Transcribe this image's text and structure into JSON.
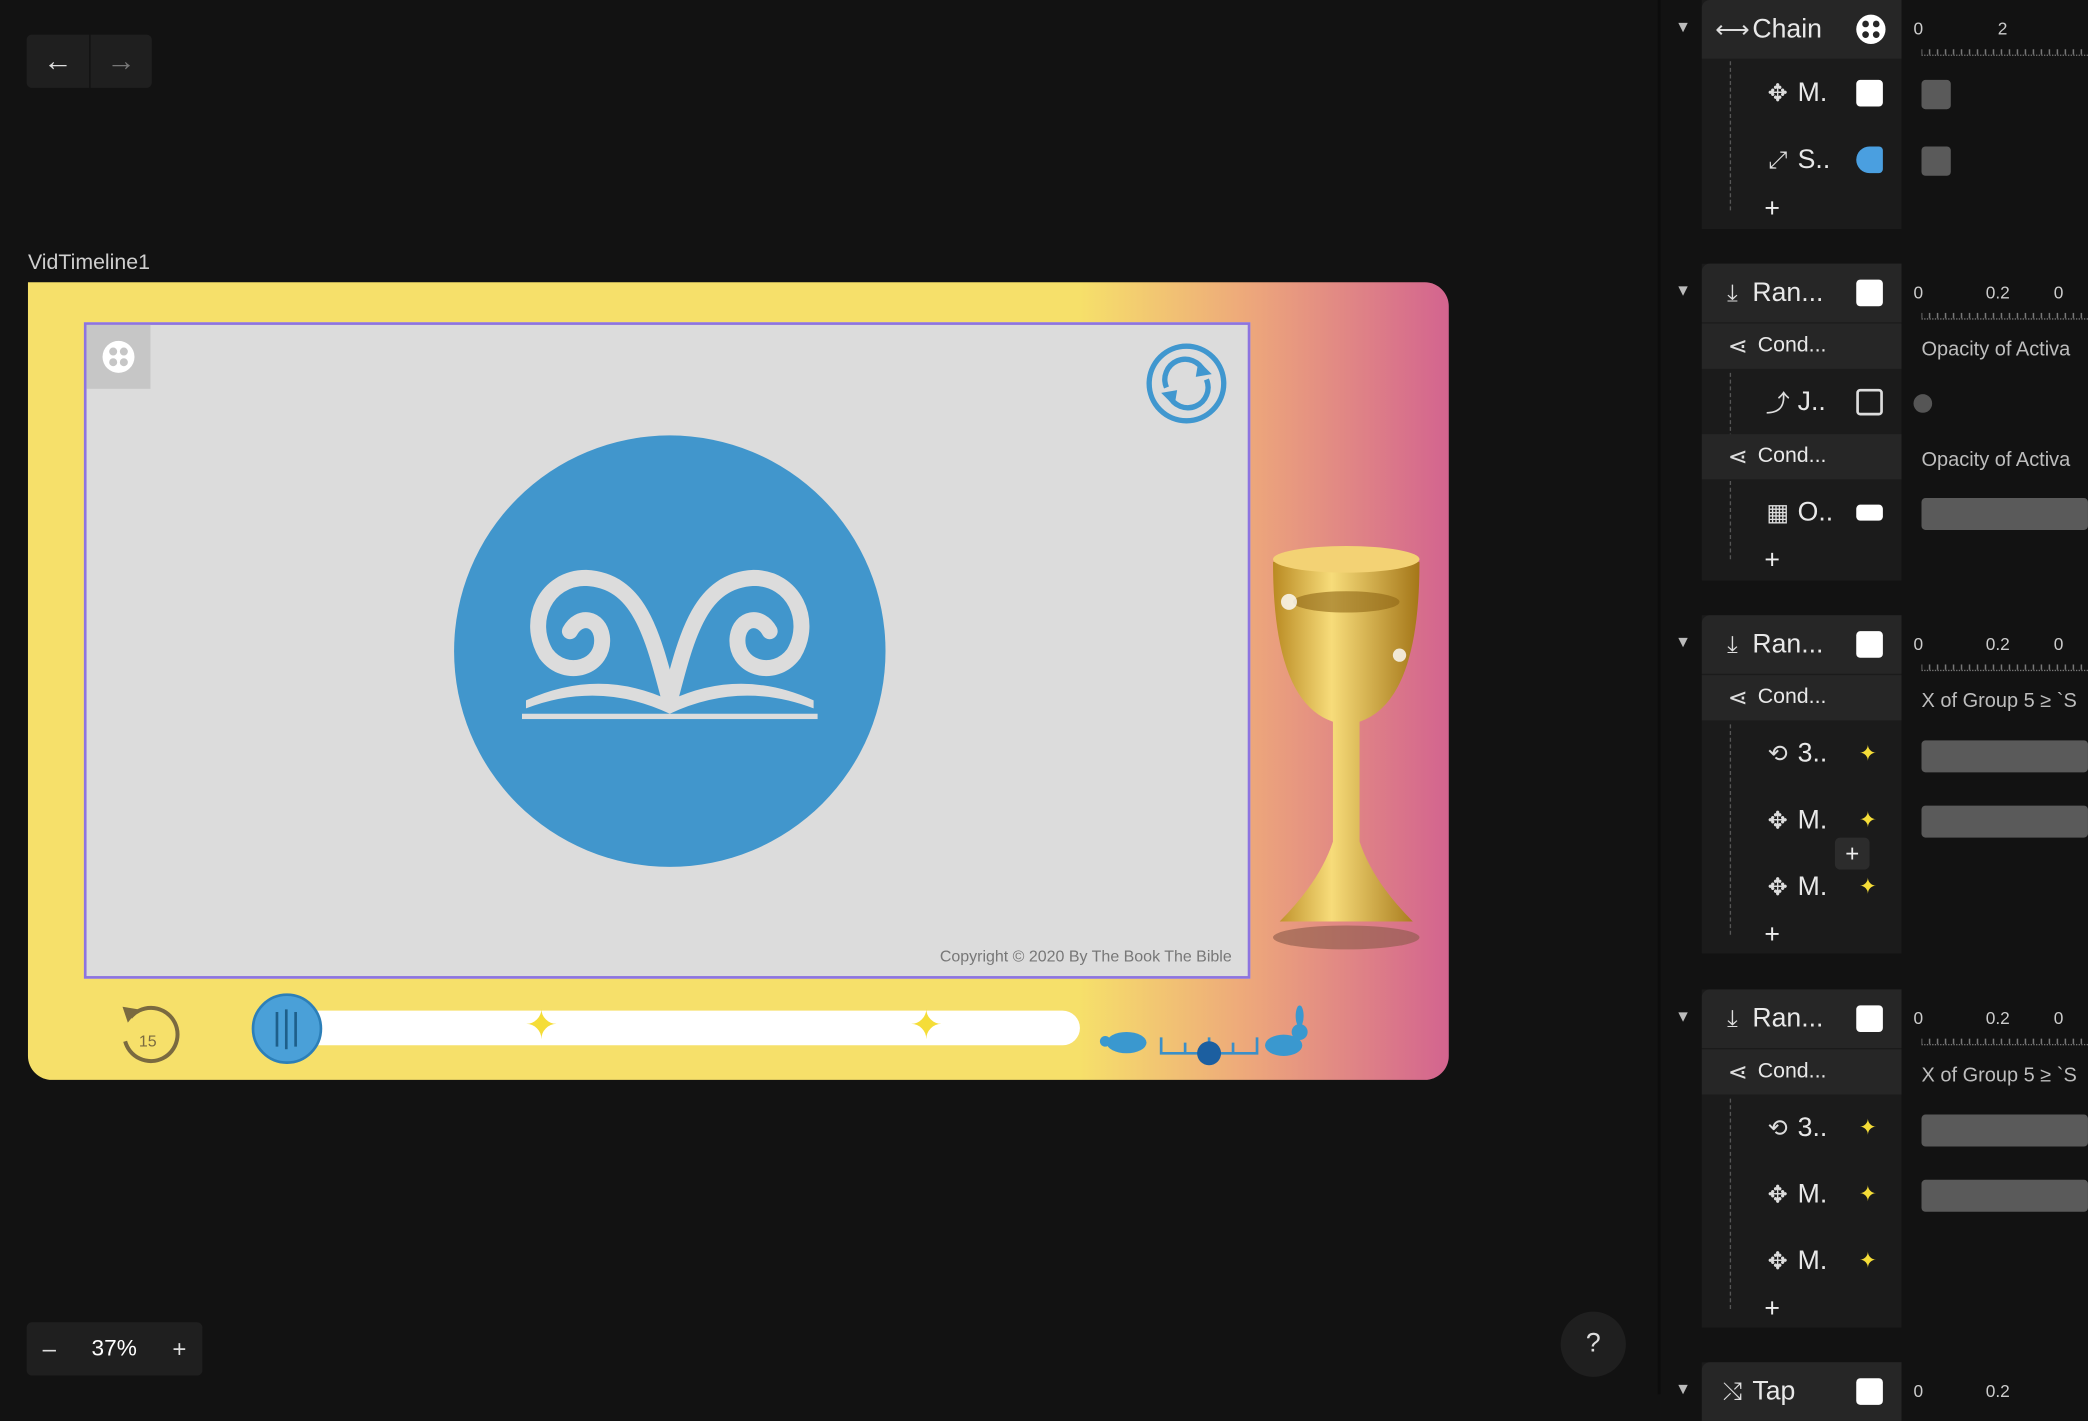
{
  "canvas": {
    "frame_label": "VidTimeline1",
    "copyright": "Copyright © 2020 By The Book The Bible",
    "replay_number": "15",
    "zoom": "37%",
    "zoom_minus": "–",
    "zoom_plus": "+",
    "help": "?"
  },
  "panel": {
    "chain": {
      "label": "Chain",
      "ruler": [
        "0",
        "2"
      ],
      "children": [
        "M.",
        "S.."
      ]
    },
    "groups": [
      {
        "label": "Ran...",
        "ruler": [
          "0",
          "0.2",
          "0"
        ],
        "conds": [
          {
            "label": "Cond...",
            "text": "Opacity of Activa",
            "child": "J.."
          },
          {
            "label": "Cond...",
            "text": "Opacity of Activa",
            "child": "O.."
          }
        ]
      },
      {
        "label": "Ran...",
        "ruler": [
          "0",
          "0.2",
          "0"
        ],
        "conds": [
          {
            "label": "Cond...",
            "text": "X of Group 5 ≥ `S",
            "children": [
              "3..",
              "M.",
              "M."
            ]
          }
        ]
      },
      {
        "label": "Ran...",
        "ruler": [
          "0",
          "0.2",
          "0"
        ],
        "conds": [
          {
            "label": "Cond...",
            "text": "X of Group 5 ≥ `S",
            "children": [
              "3..",
              "M.",
              "M."
            ]
          }
        ]
      }
    ],
    "last": {
      "label": "Tap",
      "ruler": [
        "0",
        "0.2"
      ]
    }
  }
}
